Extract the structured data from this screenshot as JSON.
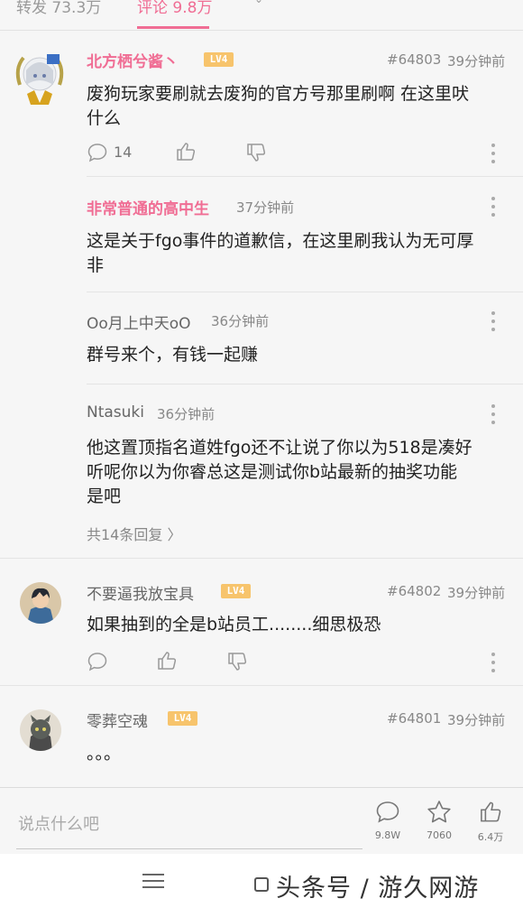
{
  "tabs": {
    "repost": "转发 73.3万",
    "comments": "评论 9.8万"
  },
  "comments": [
    {
      "user": "北方栖兮酱丶",
      "level": "LV4",
      "floor": "#64803",
      "time": "39分钟前",
      "text_lines": [
        "废狗玩家要刷就去废狗的官方号那里刷啊 在这里吠",
        "什么"
      ],
      "reply_count": "14"
    },
    {
      "user": "不要逼我放宝具",
      "level": "LV4",
      "floor": "#64802",
      "time": "39分钟前",
      "text_lines": [
        "如果抽到的全是b站员工........细思极恐"
      ]
    },
    {
      "user": "零葬空魂",
      "level": "LV4",
      "floor": "#64801",
      "time": "39分钟前",
      "text_lines": [
        "。。。"
      ]
    }
  ],
  "replies": [
    {
      "user": "非常普通的高中生",
      "time": "37分钟前",
      "text_lines": [
        "这是关于fgo事件的道歉信，在这里刷我认为无可厚",
        "非"
      ]
    },
    {
      "user": "Oo月上中天oO",
      "time": "36分钟前",
      "text_lines": [
        "群号来个，有钱一起赚"
      ]
    },
    {
      "user": "Ntasuki",
      "time": "36分钟前",
      "text_lines": [
        "他这置顶指名道姓fgo还不让说了你以为518是凑好",
        "听呢你以为你睿总这是测试你b站最新的抽奖功能",
        "是吧"
      ]
    }
  ],
  "more_replies": "共14条回复 〉",
  "bottom": {
    "input_placeholder": "说点什么吧",
    "comment_count": "9.8W",
    "favorite_count": "7060",
    "like_count": "6.4万"
  },
  "watermark": "头条号 / 游久网游",
  "colors": {
    "accent": "#f06d94",
    "level_badge": "#f7c46c"
  }
}
